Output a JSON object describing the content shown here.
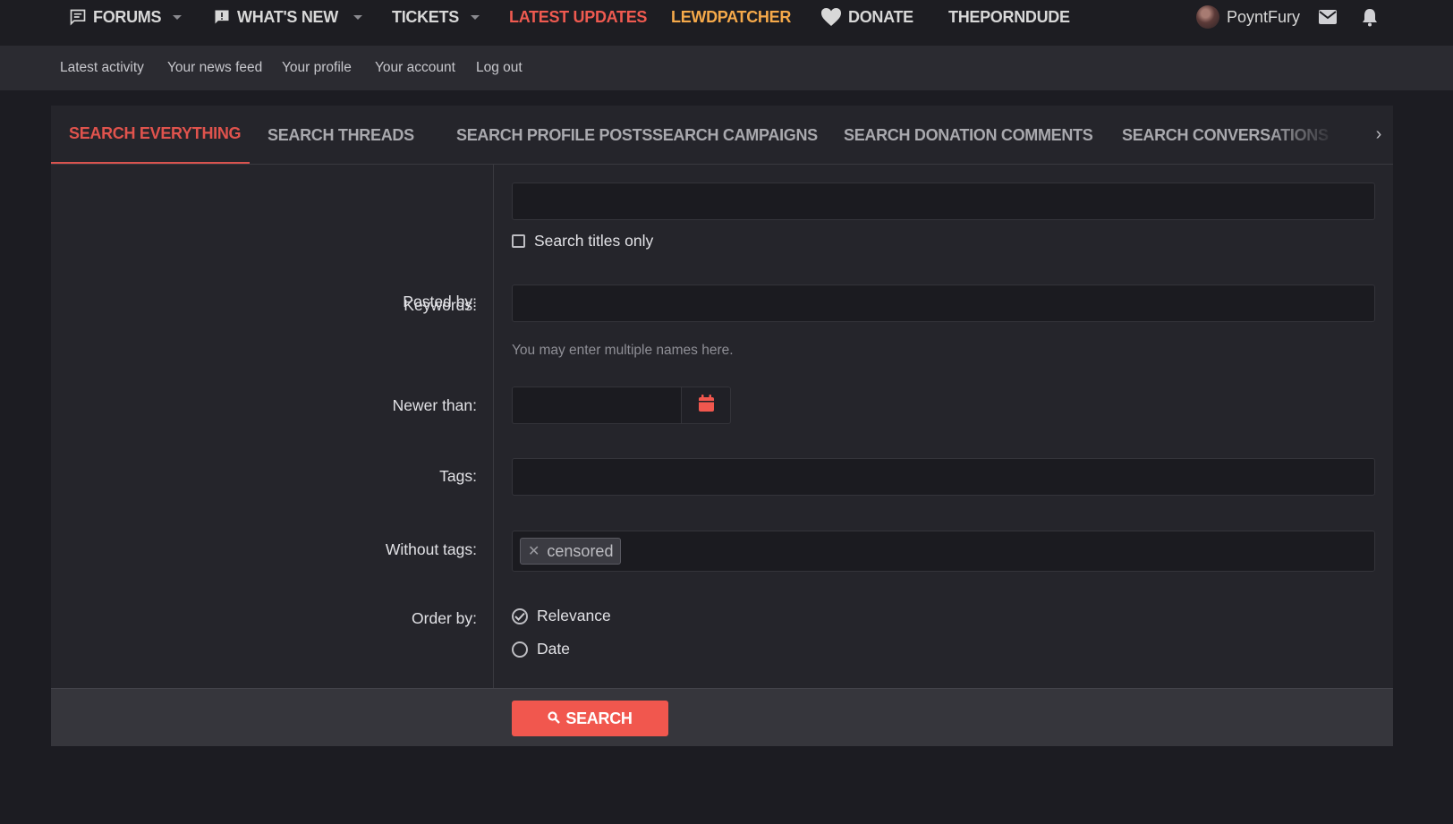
{
  "colors": {
    "accent": "#f1574e",
    "latest_updates": "#ef5a50",
    "lewdpatcher": "#f5a94a",
    "active_tab": "#e0534d"
  },
  "topnav": {
    "items": [
      {
        "label": "FORUMS",
        "icon": "forum-icon",
        "has_caret": true
      },
      {
        "label": "WHAT'S NEW",
        "icon": "alert-bubble-icon",
        "has_caret": true
      },
      {
        "label": "TICKETS",
        "icon": "",
        "has_caret": true
      },
      {
        "label": "LATEST UPDATES",
        "icon": "",
        "has_caret": false
      },
      {
        "label": "LEWDPATCHER",
        "icon": "",
        "has_caret": false
      },
      {
        "label": "DONATE",
        "icon": "heart-icon",
        "has_caret": false
      },
      {
        "label": "THEPORNDUDE",
        "icon": "",
        "has_caret": false
      }
    ],
    "username": "PoyntFury",
    "icons": [
      "mail-icon",
      "bell-icon"
    ]
  },
  "subnav": {
    "links": [
      "Latest activity",
      "Your news feed",
      "Your profile",
      "Your account",
      "Log out"
    ]
  },
  "tabs": {
    "items": [
      "SEARCH EVERYTHING",
      "SEARCH THREADS",
      "SEARCH PROFILE POSTS",
      "SEARCH CAMPAIGNS",
      "SEARCH DONATION COMMENTS",
      "SEARCH CONVERSATIONS"
    ],
    "active_index": 0,
    "scroll_glyph": "›"
  },
  "form": {
    "keywords_label": "Keywords:",
    "keywords_value": "",
    "titles_only_label": "Search titles only",
    "titles_only_checked": false,
    "posted_by_label": "Posted by:",
    "posted_by_value": "",
    "posted_by_hint": "You may enter multiple names here.",
    "newer_than_label": "Newer than:",
    "newer_than_value": "",
    "tags_label": "Tags:",
    "tags_value": "",
    "without_tags_label": "Without tags:",
    "without_tags_chips": [
      "censored"
    ],
    "order_by_label": "Order by:",
    "order_options": [
      "Relevance",
      "Date"
    ],
    "order_selected": "Relevance",
    "submit_label": "SEARCH"
  }
}
